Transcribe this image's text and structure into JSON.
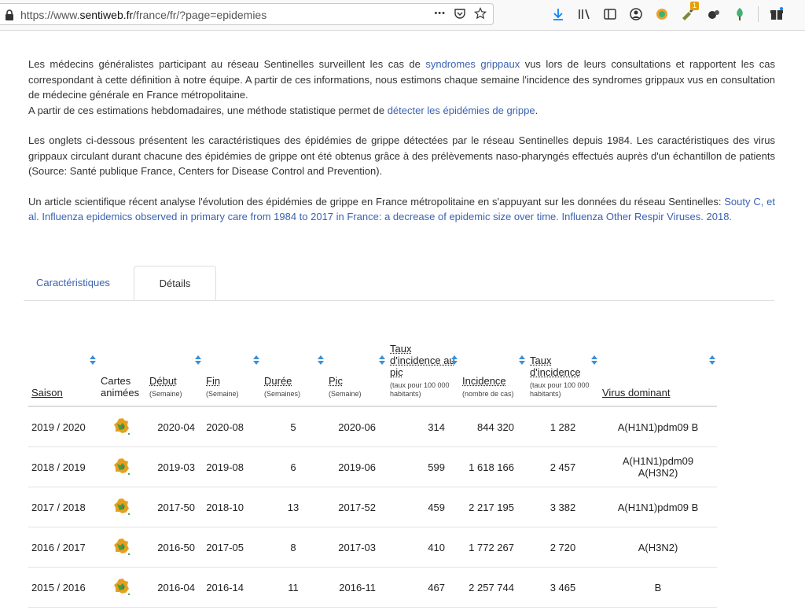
{
  "browser": {
    "url_prefix": "https://www.",
    "url_domain": "sentiweb.fr",
    "url_path": "/france/fr/?page=epidemies",
    "more_label": "•••",
    "ext_badge": "1"
  },
  "content": {
    "p1_a": "Les médecins généralistes participant au réseau Sentinelles surveillent les cas de ",
    "p1_link": "syndromes grippaux",
    "p1_b": " vus lors de leurs consultations et rapportent les cas correspondant à cette définition à notre équipe. A partir de ces informations, nous estimons chaque semaine l'incidence des syndromes grippaux vus en consultation de médecine générale en France métropolitaine.",
    "p1_c": "A partir de ces estimations hebdomadaires, une méthode statistique permet de ",
    "p1_link2": "détecter les épidémies de grippe",
    "p1_d": ".",
    "p2": "Les onglets ci-dessous présentent les caractéristiques des épidémies de grippe détectées par le réseau Sentinelles depuis 1984. Les caractéristiques des virus grippaux circulant durant chacune des épidémies de grippe ont été obtenus grâce à des prélèvements naso-pharyngés effectués auprès d'un échantillon de patients (Source: Santé publique France, Centers for Disease Control and Prevention).",
    "p3_a": "Un article scientifique récent analyse l'évolution des épidémies de grippe en France métropolitaine en s'appuyant sur les données du réseau Sentinelles: ",
    "p3_link": "Souty C, et al. Influenza epidemics observed in primary care from 1984 to 2017 in France: a decrease of epidemic size over time. Influenza Other Respir Viruses. 2018."
  },
  "tabs": [
    "Caractéristiques",
    "Détails"
  ],
  "table": {
    "headers": {
      "saison": "Saison",
      "cartes": "Cartes animées",
      "debut": "Début",
      "debut_sub": "(Semaine)",
      "fin": "Fin",
      "fin_sub": "(Semaine)",
      "duree": "Durée",
      "duree_sub": "(Semaines)",
      "pic": "Pic",
      "pic_sub": "(Semaine)",
      "taux_pic": "Taux d'incidence au pic",
      "taux_pic_sub": "(taux pour 100 000 habitants)",
      "incidence": "Incidence",
      "incidence_sub": "(nombre de cas)",
      "taux": "Taux d'incidence",
      "taux_sub": "(taux pour 100 000 habitants)",
      "virus": "Virus dominant"
    },
    "rows": [
      {
        "saison": "2019 / 2020",
        "debut": "2020-04",
        "fin": "2020-08",
        "duree": "5",
        "pic": "2020-06",
        "taux_pic": "314",
        "incidence": "844 320",
        "taux": "1 282",
        "virus": "A(H1N1)pdm09 B"
      },
      {
        "saison": "2018 / 2019",
        "debut": "2019-03",
        "fin": "2019-08",
        "duree": "6",
        "pic": "2019-06",
        "taux_pic": "599",
        "incidence": "1 618 166",
        "taux": "2 457",
        "virus": "A(H1N1)pdm09 A(H3N2)"
      },
      {
        "saison": "2017 / 2018",
        "debut": "2017-50",
        "fin": "2018-10",
        "duree": "13",
        "pic": "2017-52",
        "taux_pic": "459",
        "incidence": "2 217 195",
        "taux": "3 382",
        "virus": "A(H1N1)pdm09 B"
      },
      {
        "saison": "2016 / 2017",
        "debut": "2016-50",
        "fin": "2017-05",
        "duree": "8",
        "pic": "2017-03",
        "taux_pic": "410",
        "incidence": "1 772 267",
        "taux": "2 720",
        "virus": "A(H3N2)"
      },
      {
        "saison": "2015 / 2016",
        "debut": "2016-04",
        "fin": "2016-14",
        "duree": "11",
        "pic": "2016-11",
        "taux_pic": "467",
        "incidence": "2 257 744",
        "taux": "3 465",
        "virus": "B"
      }
    ]
  }
}
